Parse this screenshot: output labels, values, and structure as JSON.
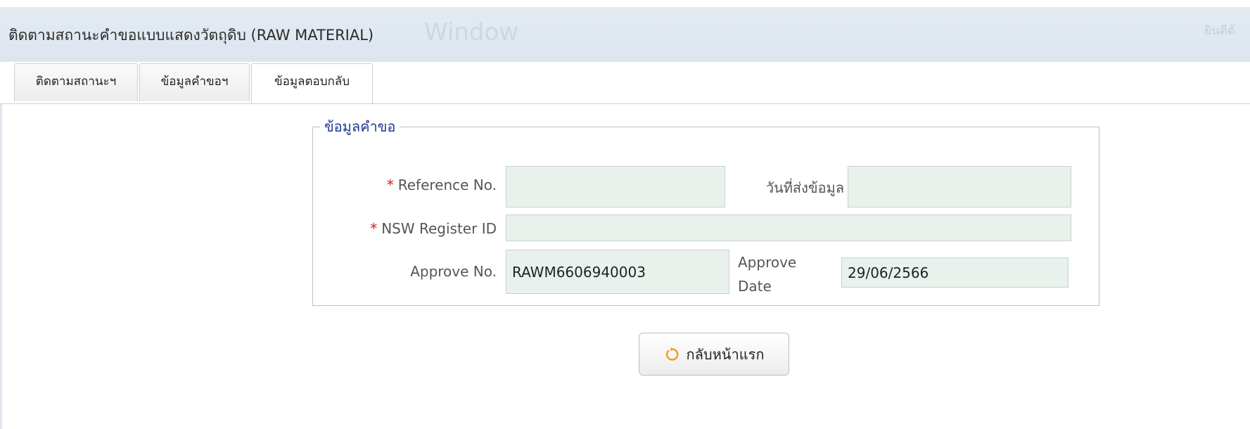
{
  "window": {
    "title": "ติดตามสถานะคำขอแบบแสดงวัตถุดิบ (RAW MATERIAL)",
    "ghost_text": "Window",
    "ghost_right": "ยินดีต้"
  },
  "tabs": [
    {
      "label": "ติดตามสถานะฯ",
      "active": false
    },
    {
      "label": "ข้อมูลคำขอฯ",
      "active": false
    },
    {
      "label": "ข้อมูลตอบกลับ",
      "active": true
    }
  ],
  "form": {
    "legend": "ข้อมูลคำขอ",
    "required_mark": "*",
    "reference_no": {
      "label": "Reference No.",
      "value": ""
    },
    "submit_date": {
      "label": "วันที่ส่งข้อมูล",
      "value": ""
    },
    "nsw_register_id": {
      "label": "NSW Register ID",
      "value": ""
    },
    "approve_no": {
      "label": "Approve No.",
      "value": "RAWM6606940003"
    },
    "approve_date": {
      "label_line1": "Approve",
      "label_line2": "Date",
      "value": "29/06/2566"
    }
  },
  "back_button": {
    "label": "กลับหน้าแรก",
    "icon": "refresh-icon"
  },
  "colors": {
    "field_background": "#e8f1ec",
    "legend_text": "#1f3a93",
    "required_mark": "#d02020",
    "icon_orange": "#f39c12"
  }
}
